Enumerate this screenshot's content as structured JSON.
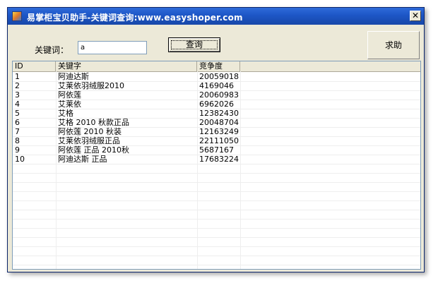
{
  "window": {
    "title": "易掌柜宝贝助手-关键词查询:www.easyshoper.com",
    "close_glyph": "✕"
  },
  "search": {
    "label": "关键词：",
    "value": "a",
    "query_button": "查询",
    "help_button": "求助"
  },
  "table": {
    "columns": [
      "ID",
      "关键字",
      "竞争度"
    ],
    "rows": [
      [
        "1",
        "阿迪达斯",
        "20059018"
      ],
      [
        "2",
        "艾莱依羽绒服2010",
        "4169046"
      ],
      [
        "3",
        "阿依莲",
        "20060983"
      ],
      [
        "4",
        "艾莱依",
        "6962026"
      ],
      [
        "5",
        "艾格",
        "12382430"
      ],
      [
        "6",
        "艾格 2010 秋款正品",
        "20048704"
      ],
      [
        "7",
        "阿依莲 2010 秋装",
        "12163249"
      ],
      [
        "8",
        "艾莱依羽绒服正品",
        "22111050"
      ],
      [
        "9",
        "阿依莲 正品 2010秋",
        "5687167"
      ],
      [
        "10",
        "阿迪达斯 正品",
        "17683224"
      ]
    ]
  },
  "colors": {
    "titlebar": "#1d56c6",
    "window_bg": "#ece9d8",
    "grid_border": "#7f9db9"
  }
}
